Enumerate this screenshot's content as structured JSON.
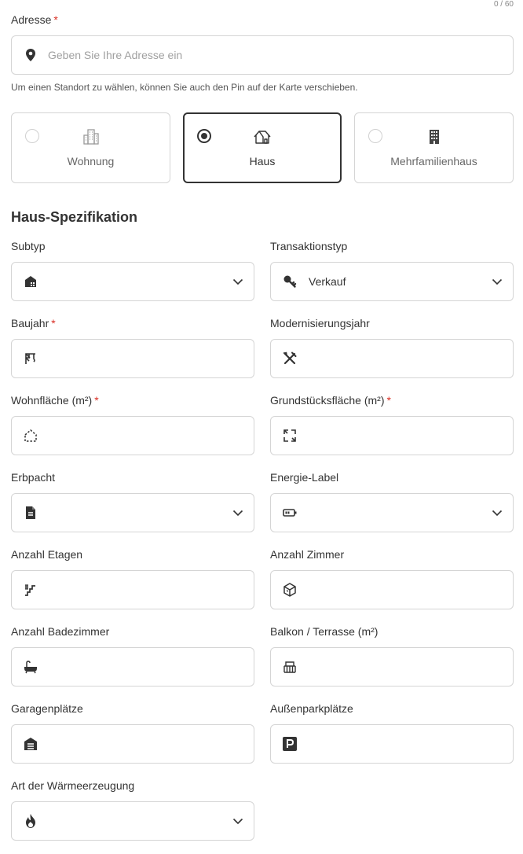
{
  "address": {
    "counter": "0 / 60",
    "label": "Adresse",
    "required_mark": "*",
    "placeholder": "Geben Sie Ihre Adresse ein",
    "icon": "map-pin-icon",
    "hint": "Um einen Standort zu wählen, können Sie auch den Pin auf der Karte verschieben."
  },
  "property_types": [
    {
      "label": "Wohnung",
      "icon": "apartment-building-icon",
      "selected": false
    },
    {
      "label": "Haus",
      "icon": "house-icon",
      "selected": true
    },
    {
      "label": "Mehrfamilienhaus",
      "icon": "multi-family-building-icon",
      "selected": false
    }
  ],
  "section_title": "Haus-Spezifikation",
  "fields": {
    "subtyp": {
      "label": "Subtyp",
      "value": "",
      "icon": "house-subtype-icon",
      "dropdown": true
    },
    "transaktionstyp": {
      "label": "Transaktionstyp",
      "value": "Verkauf",
      "icon": "key-icon",
      "dropdown": true
    },
    "baujahr": {
      "label": "Baujahr",
      "required_mark": "*",
      "value": "",
      "icon": "crane-icon"
    },
    "modernisierungsjahr": {
      "label": "Modernisierungsjahr",
      "value": "",
      "icon": "tools-icon"
    },
    "wohnflaeche": {
      "label": "Wohnfläche (m²)",
      "required_mark": "*",
      "value": "",
      "icon": "floor-area-icon"
    },
    "grundstuecksflaeche": {
      "label": "Grundstücksfläche (m²)",
      "required_mark": "*",
      "value": "",
      "icon": "expand-icon"
    },
    "erbpacht": {
      "label": "Erbpacht",
      "value": "",
      "icon": "document-icon",
      "dropdown": true
    },
    "energie_label": {
      "label": "Energie-Label",
      "value": "",
      "icon": "battery-icon",
      "dropdown": true
    },
    "anzahl_etagen": {
      "label": "Anzahl Etagen",
      "value": "",
      "icon": "stairs-icon"
    },
    "anzahl_zimmer": {
      "label": "Anzahl Zimmer",
      "value": "",
      "icon": "room-cube-icon"
    },
    "anzahl_badezimmer": {
      "label": "Anzahl Badezimmer",
      "value": "",
      "icon": "bathtub-icon"
    },
    "balkon_terrasse": {
      "label": "Balkon / Terrasse (m²)",
      "value": "",
      "icon": "balcony-icon"
    },
    "garagenplaetze": {
      "label": "Garagenplätze",
      "value": "",
      "icon": "garage-icon"
    },
    "aussenparkplaetze": {
      "label": "Außenparkplätze",
      "value": "",
      "icon": "parking-icon"
    },
    "waermeerzeugung": {
      "label": "Art der Wärmeerzeugung",
      "value": "",
      "icon": "flame-icon",
      "dropdown": true
    }
  }
}
